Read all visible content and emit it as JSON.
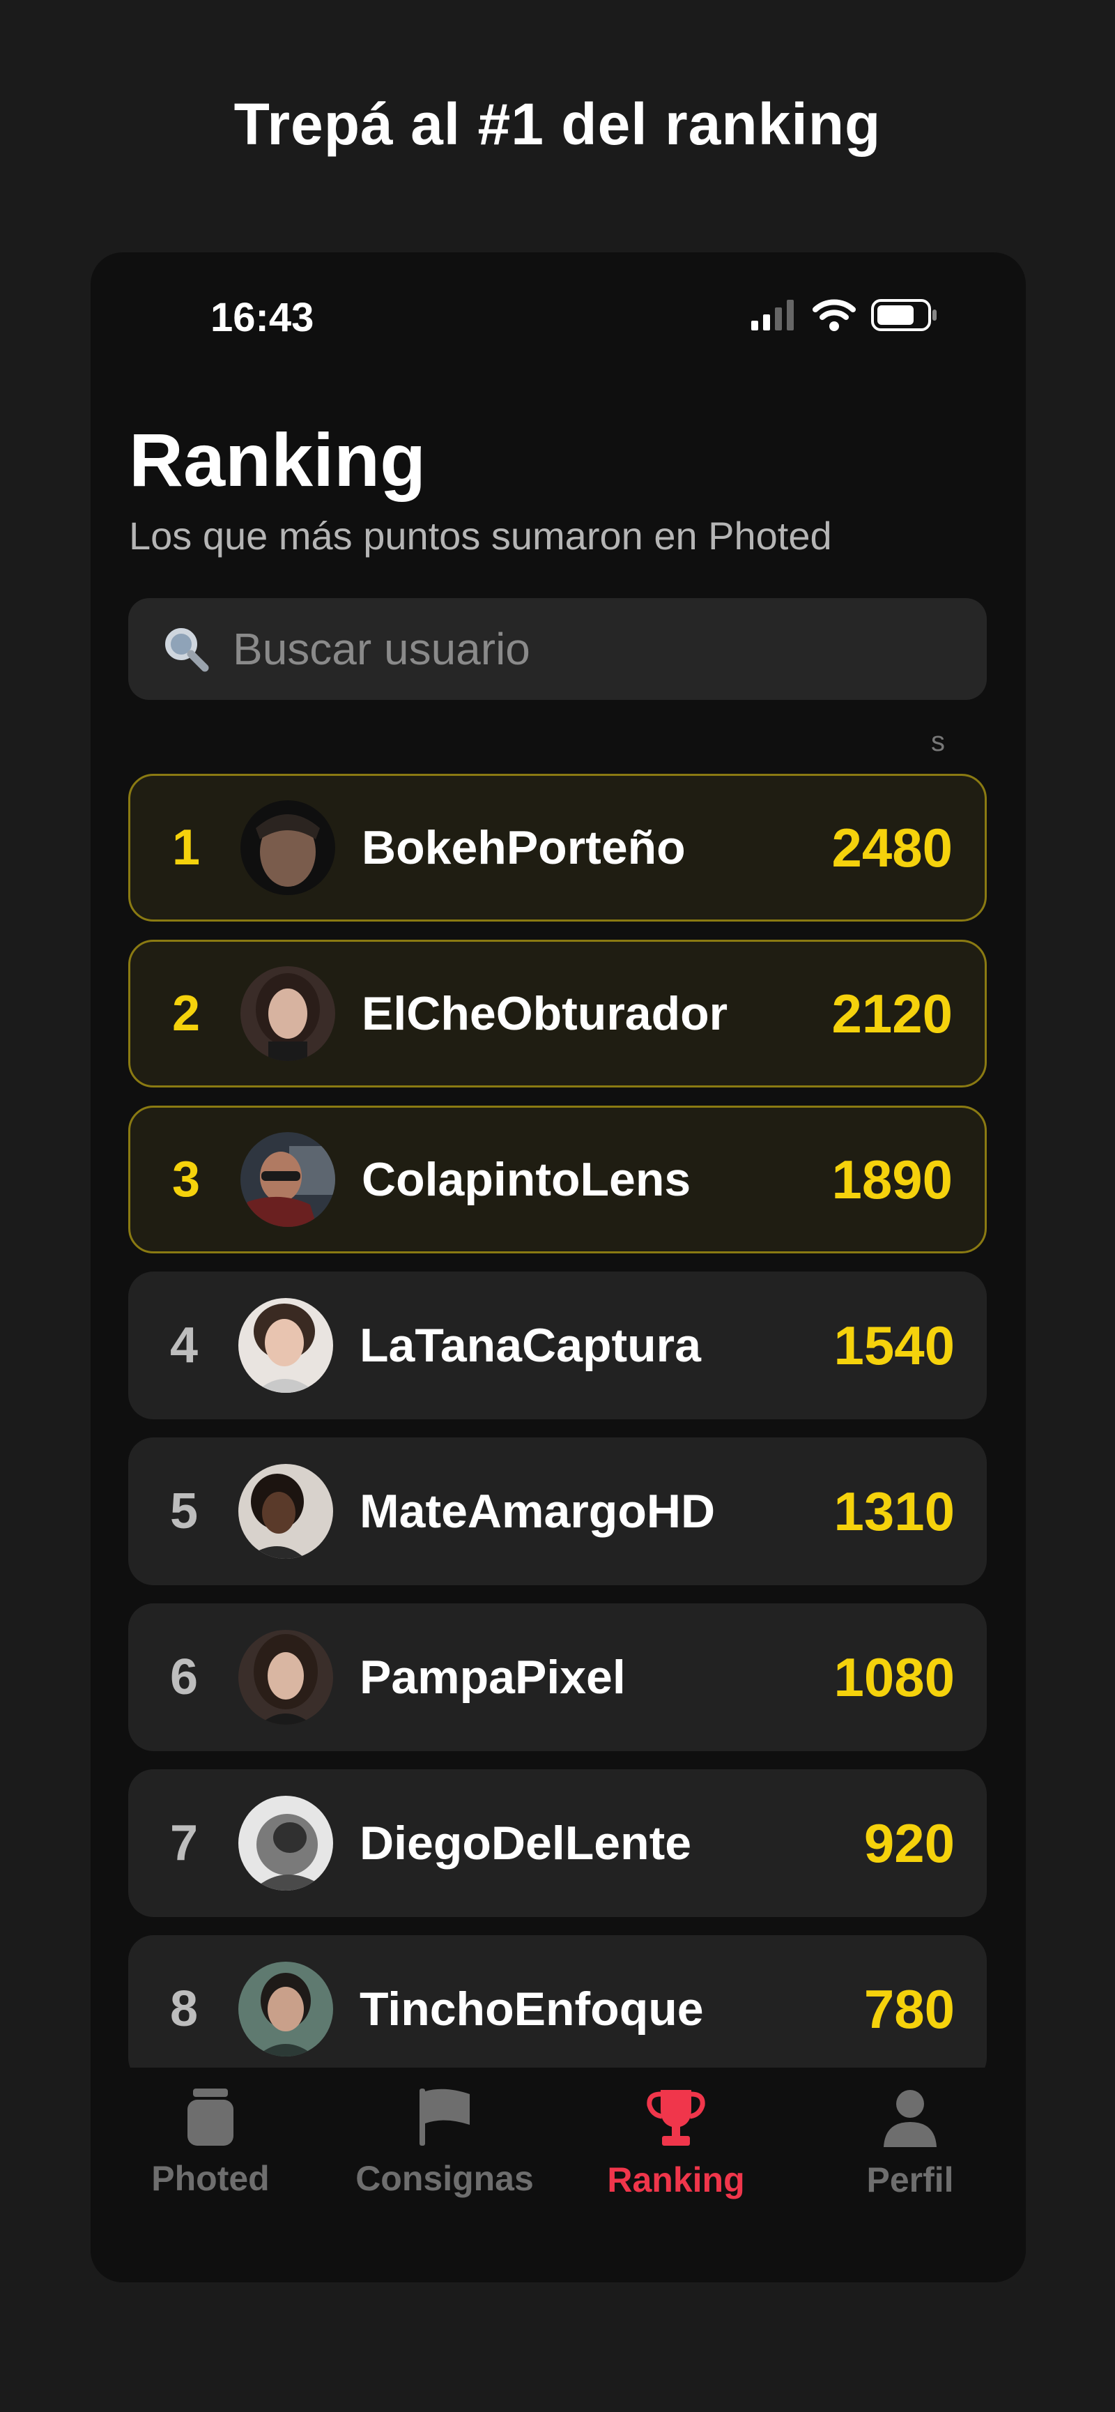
{
  "headline": "Trepá al #1 del ranking",
  "status_bar": {
    "time": "16:43"
  },
  "page": {
    "title": "Ranking",
    "subtitle": "Los que más puntos sumaron en Photed"
  },
  "search": {
    "placeholder": "Buscar usuario"
  },
  "scroll_hint": "s",
  "colors": {
    "gold": "#f5d20c",
    "accent": "#f0364b",
    "card": "#222222"
  },
  "ranking": [
    {
      "rank": "1",
      "name": "BokehPorteño",
      "points": "2480"
    },
    {
      "rank": "2",
      "name": "ElCheObturador",
      "points": "2120"
    },
    {
      "rank": "3",
      "name": "ColapintoLens",
      "points": "1890"
    },
    {
      "rank": "4",
      "name": "LaTanaCaptura",
      "points": "1540"
    },
    {
      "rank": "5",
      "name": "MateAmargoHD",
      "points": "1310"
    },
    {
      "rank": "6",
      "name": "PampaPixel",
      "points": "1080"
    },
    {
      "rank": "7",
      "name": "DiegoDelLente",
      "points": "920"
    },
    {
      "rank": "8",
      "name": "TinchoEnfoque",
      "points": "780"
    }
  ],
  "tabs": [
    {
      "label": "Photed",
      "icon": "jar-icon"
    },
    {
      "label": "Consignas",
      "icon": "flag-icon"
    },
    {
      "label": "Ranking",
      "icon": "trophy-icon"
    },
    {
      "label": "Perfil",
      "icon": "person-icon"
    }
  ]
}
